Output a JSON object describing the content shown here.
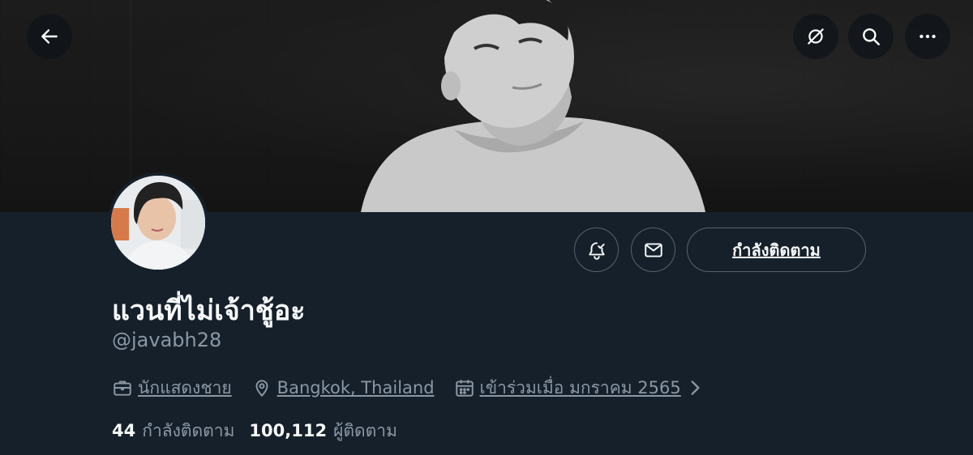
{
  "header": {
    "back_icon": "arrow-left-icon",
    "translate_icon": "no-sync-icon",
    "search_icon": "search-icon",
    "more_icon": "more-horizontal-icon"
  },
  "profile": {
    "display_name": "แวนที่ไม่เจ้าชู้อะ",
    "handle": "@javabh28",
    "profession": "นักแสดงชาย",
    "location": "Bangkok, Thailand",
    "joined": "เข้าร่วมเมื่อ มกราคม 2565"
  },
  "actions": {
    "notify_icon": "bell-check-icon",
    "message_icon": "envelope-icon",
    "following_label": "กำลังติดตาม"
  },
  "stats": {
    "following_count": "44",
    "following_label": "กำลังติดตาม",
    "followers_count": "100,112",
    "followers_label": "ผู้ติดตาม"
  },
  "colors": {
    "background": "#15202b",
    "secondary_text": "#8b98a5",
    "border": "#536471"
  }
}
